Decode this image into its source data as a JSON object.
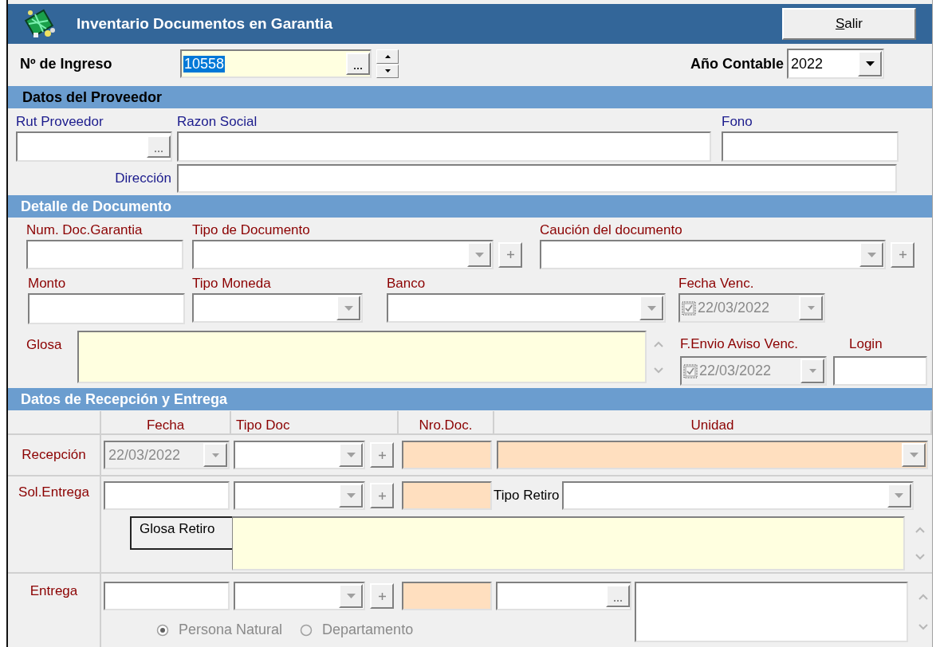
{
  "window": {
    "title": "Inventario Documentos en Garantia",
    "exit_button": "Salir"
  },
  "header": {
    "ingreso": {
      "label": "Nº de Ingreso",
      "value": "10558",
      "value_selected": true
    },
    "year": {
      "label": "Año Contable",
      "value": "2022"
    }
  },
  "proveedor": {
    "title": "Datos del Proveedor",
    "rut": "Rut Proveedor",
    "razon_social": "Razon Social",
    "fono": "Fono",
    "direccion": "Dirección"
  },
  "detalle": {
    "title": "Detalle de Documento",
    "num_doc": "Num. Doc.Garantia",
    "tipo_documento": "Tipo de Documento",
    "caucion": "Caución del documento",
    "monto": "Monto",
    "tipo_moneda": "Tipo Moneda",
    "banco": "Banco",
    "fecha_venc": {
      "label": "Fecha Venc.",
      "value": "22/03/2022",
      "checked": true,
      "disabled": true
    },
    "glosa": "Glosa",
    "aviso": {
      "label": "F.Envio Aviso Venc.",
      "value": "22/03/2022",
      "checked": true,
      "disabled": true
    },
    "login": "Login"
  },
  "recepcion": {
    "title": "Datos de Recepción y Entrega",
    "columns": [
      "Fecha",
      "Tipo Doc",
      "Nro.Doc.",
      "Unidad"
    ],
    "rows": [
      {
        "kind": "recepcion",
        "label": "Recepción",
        "fecha": {
          "value": "22/03/2022",
          "disabled": true
        }
      },
      {
        "kind": "solicitud",
        "label": "Sol.Entrega",
        "tipo_retiro": "Tipo Retiro",
        "glosa_retiro": "Glosa Retiro"
      },
      {
        "kind": "entrega",
        "label": "Entrega",
        "radios": [
          {
            "label": "Persona Natural",
            "selected": true,
            "disabled": true
          },
          {
            "label": "Departamento",
            "selected": false,
            "disabled": true
          }
        ]
      }
    ]
  }
}
